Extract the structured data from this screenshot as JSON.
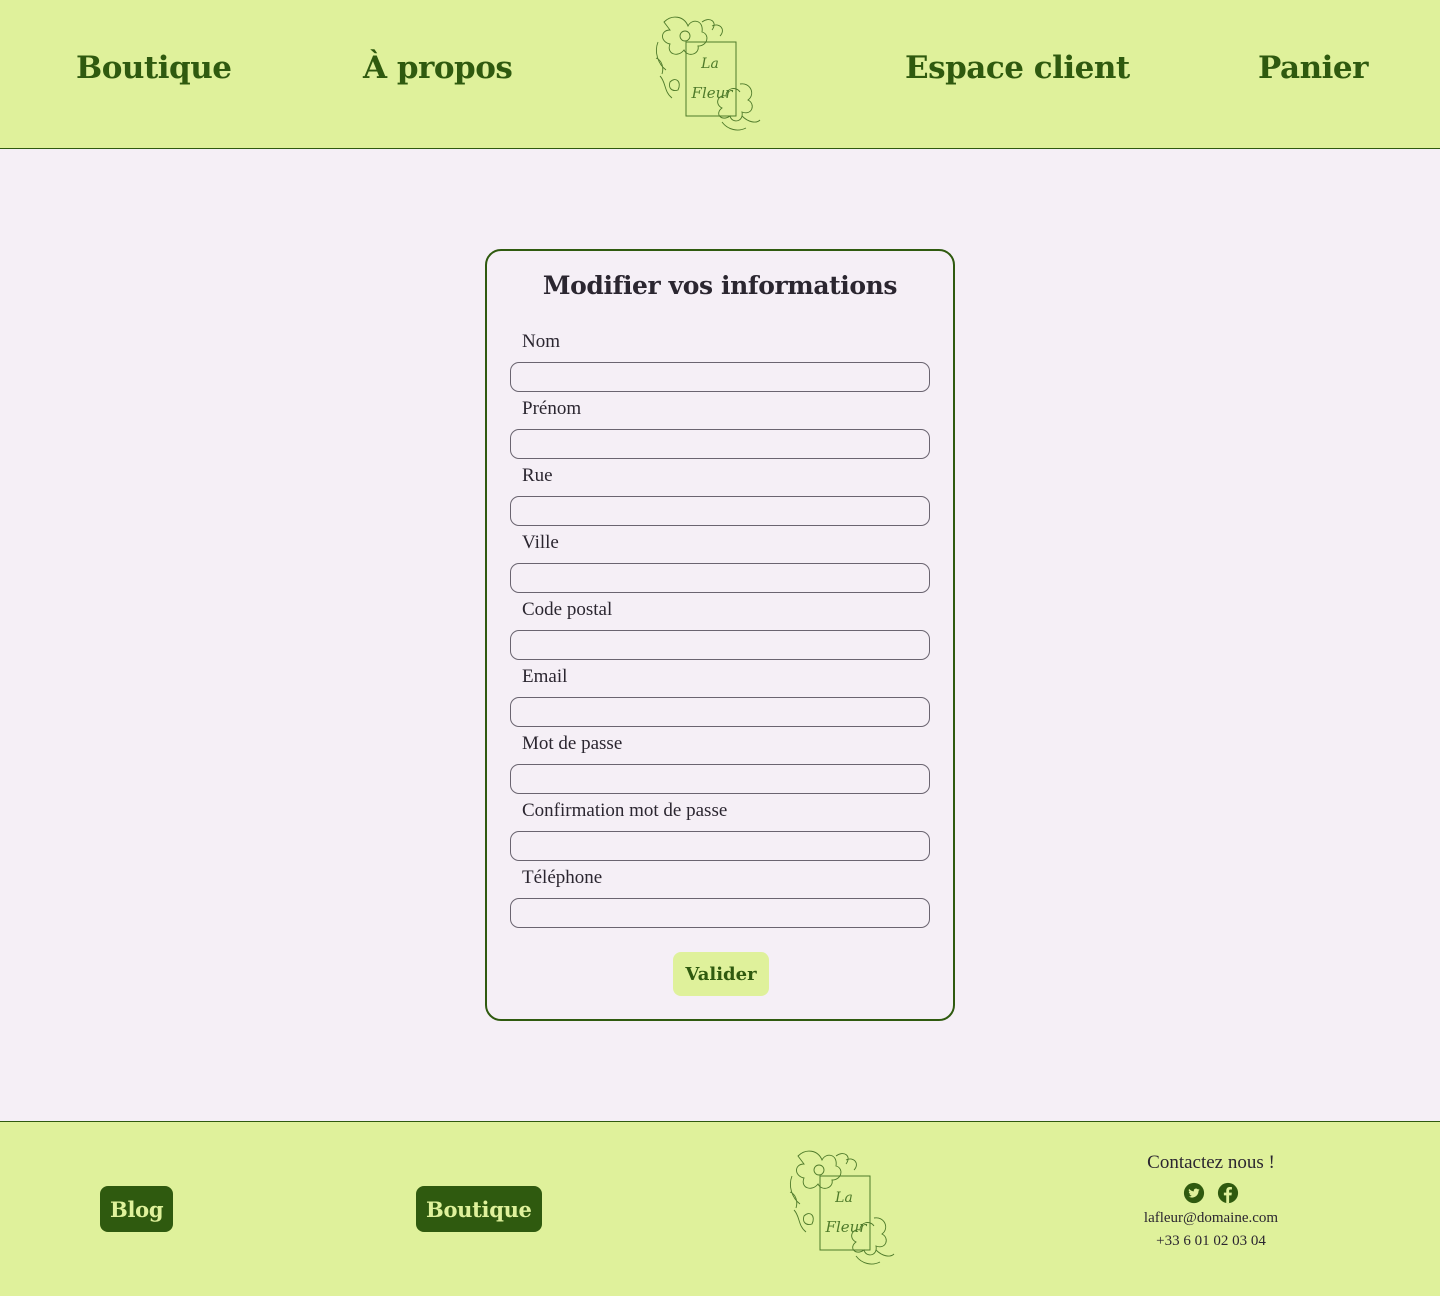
{
  "header": {
    "nav": {
      "shop": "Boutique",
      "about": "À propos",
      "account": "Espace client",
      "cart": "Panier"
    },
    "logo_text": [
      "La",
      "Fleur"
    ]
  },
  "form": {
    "title": "Modifier vos informations",
    "fields": [
      {
        "label": "Nom",
        "value": ""
      },
      {
        "label": "Prénom",
        "value": ""
      },
      {
        "label": "Rue",
        "value": ""
      },
      {
        "label": "Ville",
        "value": ""
      },
      {
        "label": "Code postal",
        "value": ""
      },
      {
        "label": "Email",
        "value": ""
      },
      {
        "label": "Mot de passe",
        "value": ""
      },
      {
        "label": "Confirmation mot de passe",
        "value": ""
      },
      {
        "label": "Téléphone",
        "value": ""
      }
    ],
    "submit_label": "Valider"
  },
  "footer": {
    "blog_label": "Blog",
    "shop_label": "Boutique",
    "contact_title": "Contactez nous !",
    "email": "lafleur@domaine.com",
    "phone": "+33 6 01 02 03 04",
    "socials": [
      "twitter-icon",
      "facebook-icon"
    ]
  },
  "colors": {
    "accent_green": "#2f5a0f",
    "light_green": "#dff19b",
    "page_bg": "#f5eff6",
    "text": "#2b2630"
  }
}
